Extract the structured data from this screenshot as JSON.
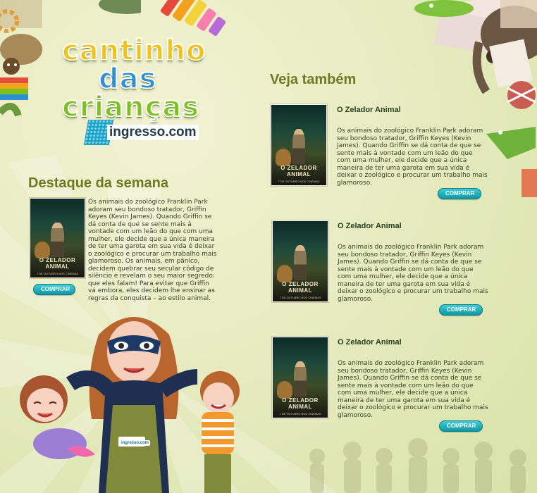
{
  "colors": {
    "accent_heading": "#6c7b22",
    "button": "#14a6b4",
    "background": "#e7ecc1"
  },
  "brand": {
    "logo_lines": [
      "cantinho",
      "das",
      "crianças"
    ],
    "partner": "ingresso.com",
    "partner_mark": "i"
  },
  "highlight": {
    "heading": "Destaque da semana",
    "poster_title": "O ZELADOR ANIMAL",
    "poster_sub": "7 DE OUTUBRO NOS CINEMAS",
    "description": "Os animais do zoológico Franklin Park adoram seu bondoso tratador, Griffin Keyes (Kevin James). Quando Griffin se dá conta de que se sente mais à vontade com um leão do que com uma mulher, ele decide que a única maneira de ter uma garota em sua vida é deixar o zoológico e procurar um trabalho mais glamoroso. Os animais, em pânico, decidem quebrar seu secular código de silêncio e revelam o seu maior segredo: que eles falam! Para evitar que Griffin vá embora, eles decidem lhe ensinar as regras da conquista – ao estilo animal.",
    "button": "COMPRAR"
  },
  "see_also": {
    "heading": "Veja também",
    "items": [
      {
        "title": "O Zelador Animal",
        "poster_title": "O ZELADOR ANIMAL",
        "poster_sub": "7 DE OUTUBRO NOS CINEMAS",
        "description": "Os animais do zoológico Franklin Park adoram seu bondoso tratador, Griffin Keyes (Kevin James). Quando Griffin se dá conta de que se sente mais à vontade com um leão do que com uma mulher, ele decide que a única maneira de ter uma garota em sua vida é deixar o zoológico e procurar um trabalho mais glamoroso.",
        "button": "COMPRAR"
      },
      {
        "title": "O Zelador Animal",
        "poster_title": "O ZELADOR ANIMAL",
        "poster_sub": "7 DE OUTUBRO NOS CINEMAS",
        "description": "Os animais do zoológico Franklin Park adoram seu bondoso tratador, Griffin Keyes (Kevin James). Quando Griffin se dá conta de que se sente mais à vontade com um leão do que com uma mulher, ele decide que a única maneira de ter uma garota em sua vida é deixar o zoológico e procurar um trabalho mais glamoroso.",
        "button": "COMPRAR"
      },
      {
        "title": "O Zelador Animal",
        "poster_title": "O ZELADOR ANIMAL",
        "poster_sub": "7 DE OUTUBRO NOS CINEMAS",
        "description": "Os animais do zoológico Franklin Park adoram seu bondoso tratador, Griffin Keyes (Kevin James). Quando Griffin se dá conta de que se sente mais à vontade com um leão do que com uma mulher, ele decide que a única maneira de ter uma garota em sua vida é deixar o zoológico e procurar um trabalho mais glamoroso.",
        "button": "COMPRAR"
      }
    ]
  },
  "mascot": {
    "badge": "ingresso.com"
  }
}
